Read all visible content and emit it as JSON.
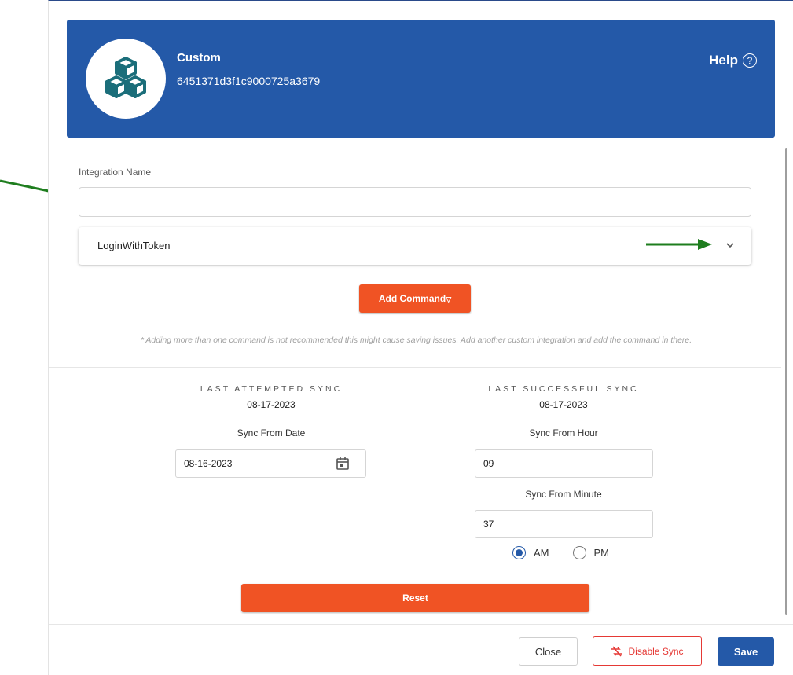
{
  "header": {
    "title": "Custom",
    "id": "6451371d3f1c9000725a3679",
    "help_label": "Help",
    "help_icon": "question-circle-icon",
    "avatar_icon": "cubes-icon"
  },
  "form": {
    "integration_name_label": "Integration Name",
    "integration_name_value": "",
    "command_name": "LoginWithToken",
    "add_command_label": "Add Command",
    "note": "* Adding more than one command is not recommended this might cause saving issues. Add another custom integration and add the command in there."
  },
  "sync": {
    "last_attempted_label": "LAST ATTEMPTED SYNC",
    "last_attempted_value": "08-17-2023",
    "last_successful_label": "LAST SUCCESSFUL SYNC",
    "last_successful_value": "08-17-2023",
    "from_date_label": "Sync From Date",
    "from_date_value": "08-16-2023",
    "from_hour_label": "Sync From Hour",
    "from_hour_value": "09",
    "from_minute_label": "Sync From Minute",
    "from_minute_value": "37",
    "am_label": "AM",
    "pm_label": "PM",
    "selected_period": "AM",
    "reset_label": "Reset"
  },
  "footer": {
    "close_label": "Close",
    "disable_sync_label": "Disable Sync",
    "save_label": "Save"
  },
  "colors": {
    "header_blue": "#2459a8",
    "accent_orange": "#f05324",
    "danger_red": "#e53935",
    "annotation_arrow_green": "#1e7d1e"
  }
}
